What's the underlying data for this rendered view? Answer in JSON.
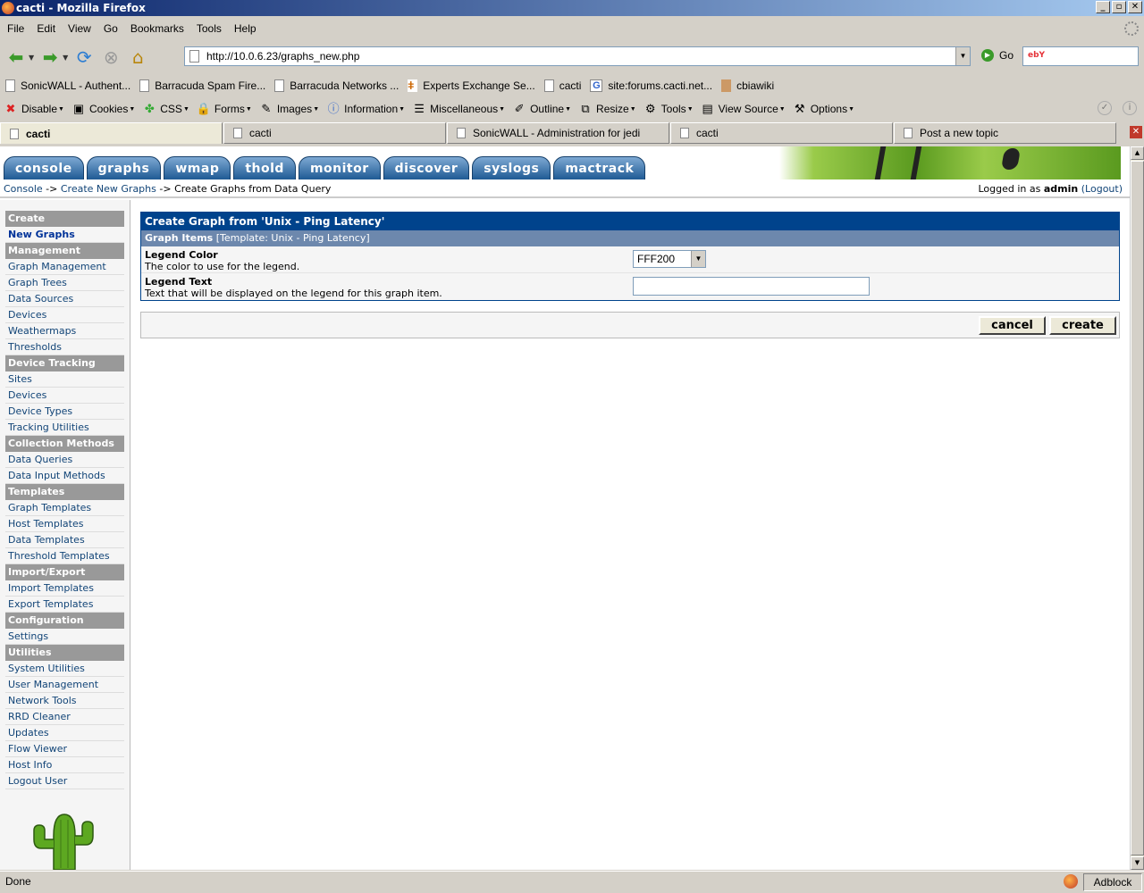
{
  "window": {
    "title": "cacti - Mozilla Firefox"
  },
  "menu": [
    "File",
    "Edit",
    "View",
    "Go",
    "Bookmarks",
    "Tools",
    "Help"
  ],
  "nav": {
    "url": "http://10.0.6.23/graphs_new.php",
    "go_label": "Go",
    "search_engine": "ebY"
  },
  "bookmarks": [
    "SonicWALL - Authent...",
    "Barracuda Spam Fire...",
    "Barracuda Networks ...",
    "Experts Exchange Se...",
    "cacti",
    "site:forums.cacti.net...",
    "cbiawiki"
  ],
  "webdev": [
    "Disable",
    "Cookies",
    "CSS",
    "Forms",
    "Images",
    "Information",
    "Miscellaneous",
    "Outline",
    "Resize",
    "Tools",
    "View Source",
    "Options"
  ],
  "tabs": [
    "cacti",
    "cacti",
    "SonicWALL - Administration for jedi",
    "cacti",
    "Post a new topic"
  ],
  "cacti": {
    "top_tabs": [
      "console",
      "graphs",
      "wmap",
      "thold",
      "monitor",
      "discover",
      "syslogs",
      "mactrack"
    ],
    "breadcrumb": {
      "console": "Console",
      "sep1": "->",
      "create_new": "Create New Graphs",
      "sep2": "->",
      "current": "Create Graphs from Data Query"
    },
    "login": {
      "prefix": "Logged in as",
      "user": "admin",
      "logout": "(Logout)"
    },
    "sidebar": [
      {
        "type": "head",
        "label": "Create"
      },
      {
        "type": "item",
        "label": "New Graphs",
        "selected": true
      },
      {
        "type": "head",
        "label": "Management"
      },
      {
        "type": "item",
        "label": "Graph Management"
      },
      {
        "type": "item",
        "label": "Graph Trees"
      },
      {
        "type": "item",
        "label": "Data Sources"
      },
      {
        "type": "item",
        "label": "Devices"
      },
      {
        "type": "item",
        "label": "Weathermaps"
      },
      {
        "type": "item",
        "label": "Thresholds"
      },
      {
        "type": "head",
        "label": "Device Tracking"
      },
      {
        "type": "item",
        "label": "Sites"
      },
      {
        "type": "item",
        "label": "Devices"
      },
      {
        "type": "item",
        "label": "Device Types"
      },
      {
        "type": "item",
        "label": "Tracking Utilities"
      },
      {
        "type": "head",
        "label": "Collection Methods"
      },
      {
        "type": "item",
        "label": "Data Queries"
      },
      {
        "type": "item",
        "label": "Data Input Methods"
      },
      {
        "type": "head",
        "label": "Templates"
      },
      {
        "type": "item",
        "label": "Graph Templates"
      },
      {
        "type": "item",
        "label": "Host Templates"
      },
      {
        "type": "item",
        "label": "Data Templates"
      },
      {
        "type": "item",
        "label": "Threshold Templates"
      },
      {
        "type": "head",
        "label": "Import/Export"
      },
      {
        "type": "item",
        "label": "Import Templates"
      },
      {
        "type": "item",
        "label": "Export Templates"
      },
      {
        "type": "head",
        "label": "Configuration"
      },
      {
        "type": "item",
        "label": "Settings"
      },
      {
        "type": "head",
        "label": "Utilities"
      },
      {
        "type": "item",
        "label": "System Utilities"
      },
      {
        "type": "item",
        "label": "User Management"
      },
      {
        "type": "item",
        "label": "Network Tools"
      },
      {
        "type": "item",
        "label": "RRD Cleaner"
      },
      {
        "type": "item",
        "label": "Updates"
      },
      {
        "type": "item",
        "label": "Flow Viewer"
      },
      {
        "type": "item",
        "label": "Host Info"
      },
      {
        "type": "item",
        "label": "Logout User"
      }
    ],
    "panel": {
      "title": "Create Graph from 'Unix - Ping Latency'",
      "sub_bold": "Graph Items",
      "sub_rest": "[Template: Unix - Ping Latency]",
      "legend_color": {
        "label": "Legend Color",
        "desc": "The color to use for the legend.",
        "value": "FFF200"
      },
      "legend_text": {
        "label": "Legend Text",
        "desc": "Text that will be displayed on the legend for this graph item.",
        "value": ""
      }
    },
    "buttons": {
      "cancel": "cancel",
      "create": "create"
    }
  },
  "status": {
    "text": "Done",
    "adblock": "Adblock"
  }
}
